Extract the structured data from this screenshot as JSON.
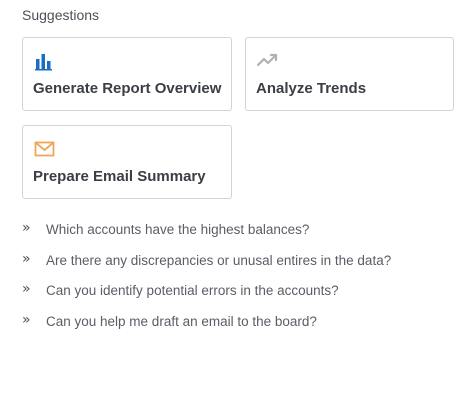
{
  "suggestions": {
    "title": "Suggestions",
    "cards": [
      {
        "label": "Generate Report Overview",
        "icon": "bar-chart-icon",
        "icon_color": "#1a6fc0"
      },
      {
        "label": "Analyze Trends",
        "icon": "trend-up-icon",
        "icon_color": "#b0b1b5"
      },
      {
        "label": "Prepare Email Summary",
        "icon": "envelope-icon",
        "icon_color": "#f0a55a"
      }
    ],
    "questions": [
      {
        "text": "Which accounts have the highest balances?"
      },
      {
        "text": "Are there any discrepancies or unusal entires in the data?"
      },
      {
        "text": "Can you identify potential errors in the accounts?"
      },
      {
        "text": "Can you help me draft an email to the board?"
      }
    ],
    "bullet_glyph": "»"
  }
}
